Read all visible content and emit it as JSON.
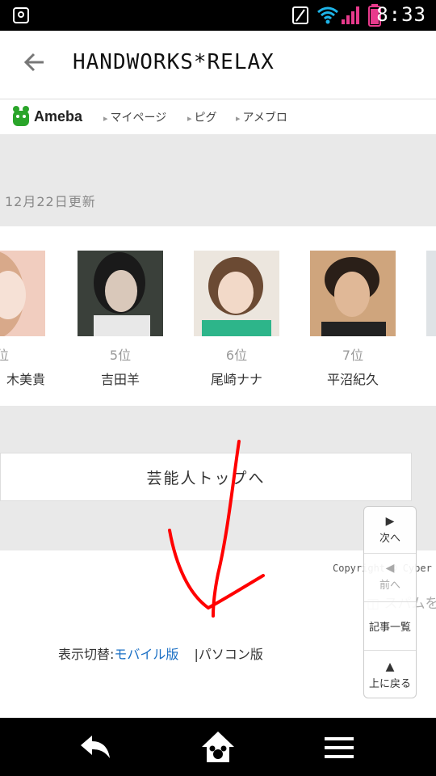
{
  "status_bar": {
    "time": "8:33"
  },
  "app_bar": {
    "title": "HANDWORKS*RELAX"
  },
  "ameba_nav": {
    "logo": "Ameba",
    "links": [
      "マイページ",
      "ピグ",
      "アメブロ"
    ]
  },
  "ranking": {
    "updated": "12月22日更新",
    "items": [
      {
        "rank": "位",
        "name": "木美貴",
        "photo_bg": "#f0c8b8"
      },
      {
        "rank": "5位",
        "name": "吉田羊",
        "photo_bg": "#3a3f3a"
      },
      {
        "rank": "6位",
        "name": "尾崎ナナ",
        "photo_bg": "#e8e2da"
      },
      {
        "rank": "7位",
        "name": "平沼紀久",
        "photo_bg": "#c9a37e"
      }
    ]
  },
  "top_button": "芸能人トップへ",
  "footer": {
    "copyright": "Copyright © Cyber",
    "spam": "スパムを",
    "display_switch_label": "表示切替:",
    "mobile_version": "モバイル版",
    "separator": "|",
    "pc_version": "パソコン版"
  },
  "float_nav": {
    "next": "次へ",
    "prev": "前へ",
    "list": "記事一覧",
    "top": "上に戻る"
  },
  "colors": {
    "link_blue": "#1a6fc4",
    "annotation_red": "#ff0000",
    "ameba_green": "#2aa52a"
  }
}
